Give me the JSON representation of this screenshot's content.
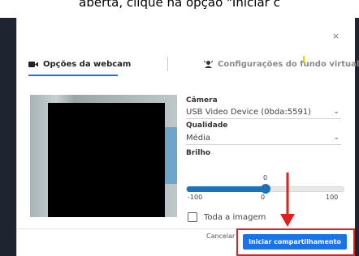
{
  "caption": "aberta, clique na opção \"Iniciar c",
  "dialog": {
    "close_label": "×",
    "tabs": [
      {
        "label": "Opções da webcam",
        "icon": "camera-icon",
        "active": true
      },
      {
        "label": "Configurações do fundo virtual",
        "icon": "virtual-background-icon",
        "active": false
      }
    ],
    "camera": {
      "label": "Câmera",
      "value": "USB Video Device (0bda:5591)"
    },
    "quality": {
      "label": "Qualidade",
      "value": "Média"
    },
    "brightness": {
      "label": "Brilho",
      "min": -100,
      "max": 100,
      "value": 0,
      "min_label": "-100",
      "mid_label": "0",
      "max_label": "100",
      "value_label": "0"
    },
    "whole_image": {
      "label": "Toda a imagem",
      "checked": false
    },
    "buttons": {
      "cancel": "Cancelar",
      "start": "Iniciar compartilhamento"
    }
  },
  "colors": {
    "accent": "#1a73e8",
    "slider": "#1b72b8",
    "highlight": "#e0201e"
  }
}
